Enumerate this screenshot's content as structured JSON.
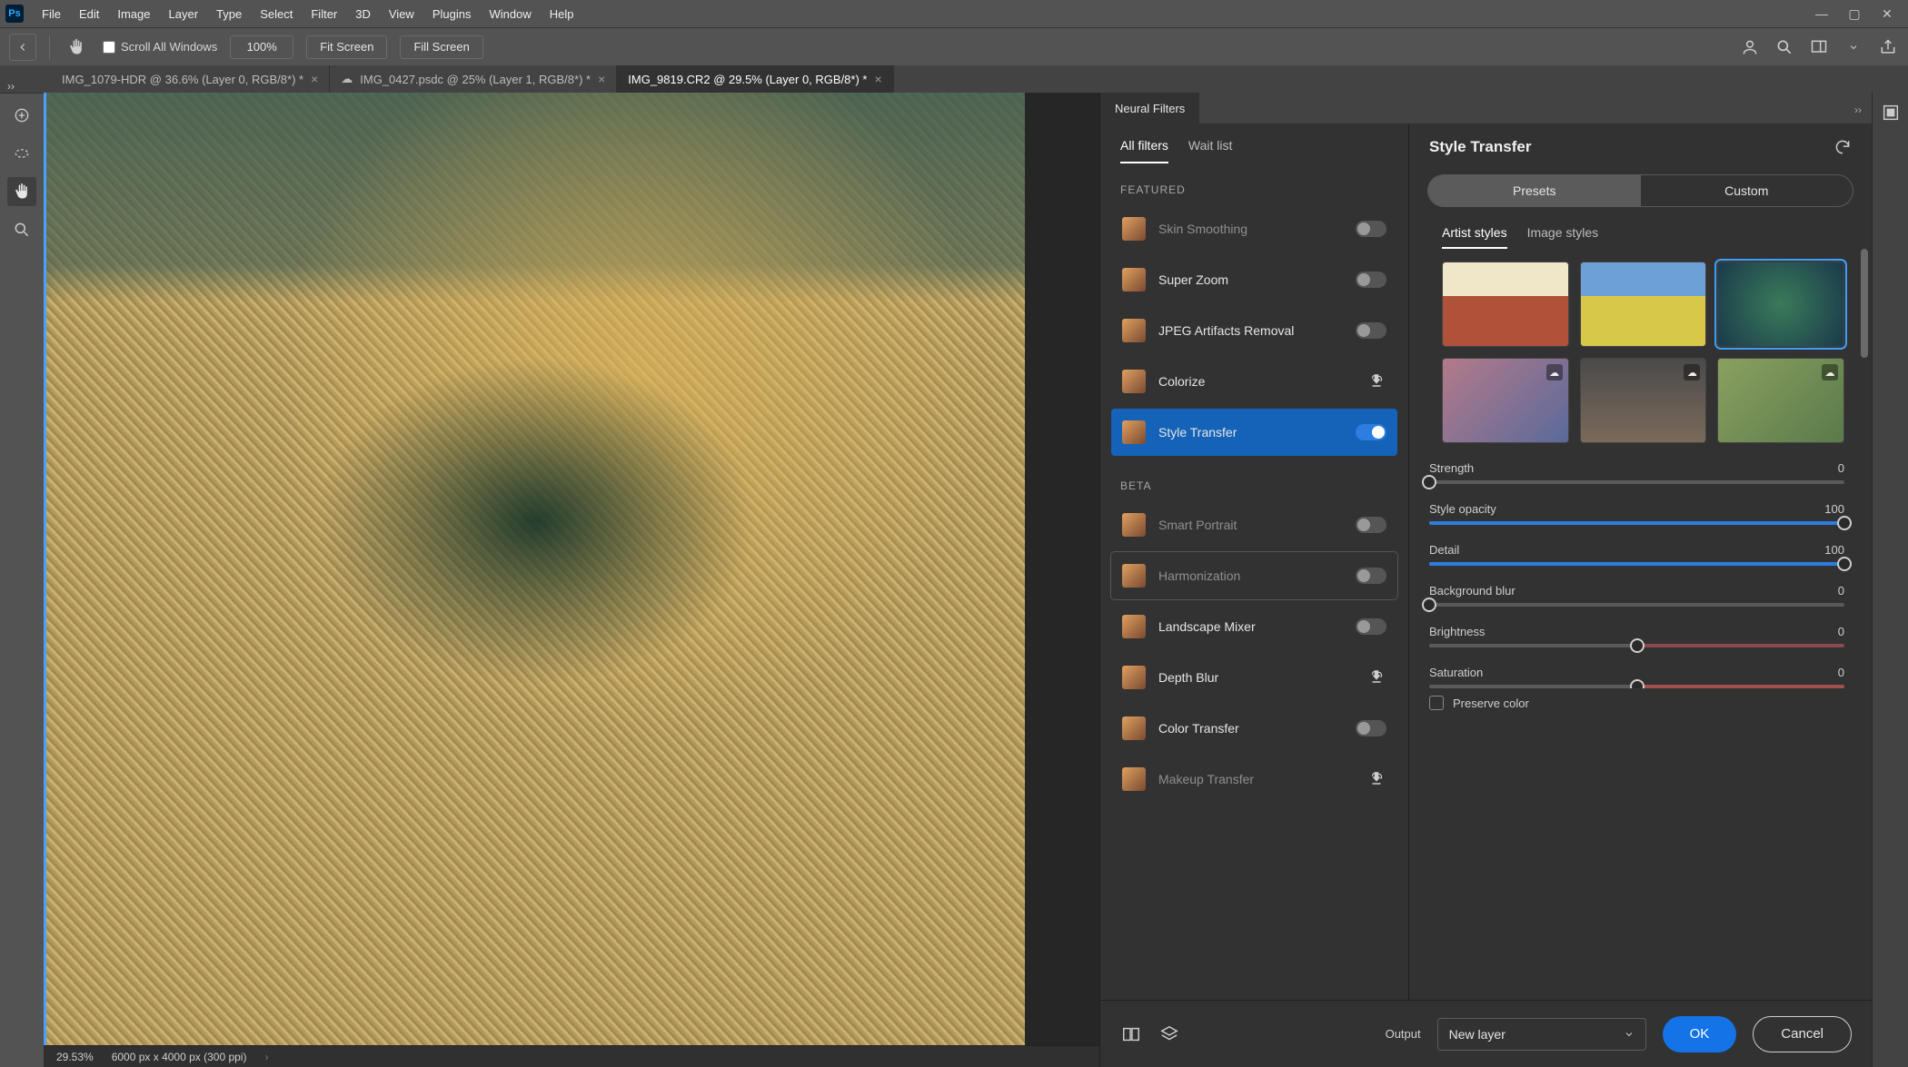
{
  "menu": [
    "File",
    "Edit",
    "Image",
    "Layer",
    "Type",
    "Select",
    "Filter",
    "3D",
    "View",
    "Plugins",
    "Window",
    "Help"
  ],
  "optbar": {
    "scroll_all": "Scroll All Windows",
    "zoom": "100%",
    "fit": "Fit Screen",
    "fill": "Fill Screen"
  },
  "tabs": [
    {
      "label": "IMG_1079-HDR @ 36.6% (Layer 0, RGB/8*) *",
      "cloud": false,
      "active": false
    },
    {
      "label": "IMG_0427.psdc @ 25% (Layer 1, RGB/8*) *",
      "cloud": true,
      "active": false
    },
    {
      "label": "IMG_9819.CR2 @ 29.5% (Layer 0, RGB/8*) *",
      "cloud": false,
      "active": true
    }
  ],
  "status": {
    "zoom": "29.53%",
    "dims": "6000 px x 4000 px (300 ppi)"
  },
  "nf": {
    "panel_title": "Neural Filters",
    "subtabs": {
      "all": "All filters",
      "wait": "Wait list"
    },
    "sections": {
      "featured": "FEATURED",
      "beta": "BETA"
    },
    "featured": [
      {
        "name": "Skin Smoothing",
        "state": "toggle-off",
        "disabled": true
      },
      {
        "name": "Super Zoom",
        "state": "toggle-off"
      },
      {
        "name": "JPEG Artifacts Removal",
        "state": "toggle-off"
      },
      {
        "name": "Colorize",
        "state": "download"
      },
      {
        "name": "Style Transfer",
        "state": "toggle-on",
        "active": true
      }
    ],
    "beta": [
      {
        "name": "Smart Portrait",
        "state": "toggle-off",
        "disabled": true
      },
      {
        "name": "Harmonization",
        "state": "toggle-off",
        "disabled": true,
        "hover": true
      },
      {
        "name": "Landscape Mixer",
        "state": "toggle-off"
      },
      {
        "name": "Depth Blur",
        "state": "download"
      },
      {
        "name": "Color Transfer",
        "state": "toggle-off"
      },
      {
        "name": "Makeup Transfer",
        "state": "download",
        "disabled": true
      }
    ],
    "right": {
      "title": "Style Transfer",
      "seg": {
        "presets": "Presets",
        "custom": "Custom"
      },
      "sub2": {
        "artist": "Artist styles",
        "image": "Image styles"
      },
      "sliders": [
        {
          "key": "strength",
          "label": "Strength",
          "value": 0,
          "min": 0,
          "max": 100,
          "pos": 0
        },
        {
          "key": "style_opacity",
          "label": "Style opacity",
          "value": 100,
          "min": 0,
          "max": 100,
          "pos": 100
        },
        {
          "key": "detail",
          "label": "Detail",
          "value": 100,
          "min": 0,
          "max": 100,
          "pos": 100
        },
        {
          "key": "bg_blur",
          "label": "Background blur",
          "value": 0,
          "min": 0,
          "max": 100,
          "pos": 0
        },
        {
          "key": "brightness",
          "label": "Brightness",
          "value": 0,
          "min": -100,
          "max": 100,
          "pos": 50,
          "center": true
        },
        {
          "key": "saturation",
          "label": "Saturation",
          "value": 0,
          "min": -100,
          "max": 100,
          "pos": 50,
          "center": true
        }
      ],
      "preserve_color": "Preserve color"
    },
    "footer": {
      "output_label": "Output",
      "output_value": "New layer",
      "ok": "OK",
      "cancel": "Cancel"
    }
  }
}
